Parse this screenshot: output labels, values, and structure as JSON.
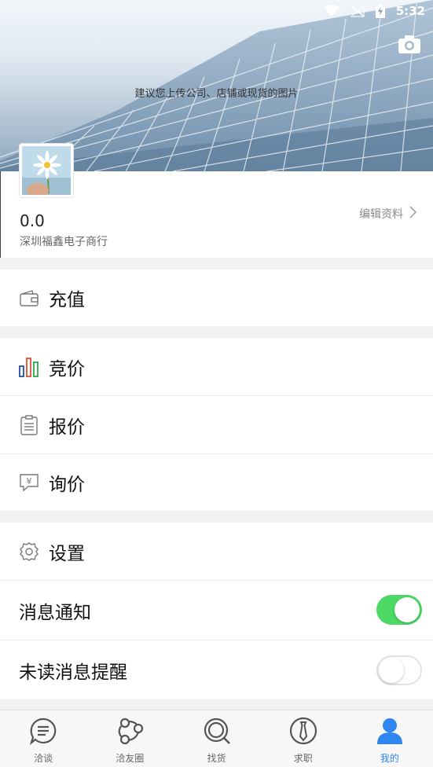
{
  "status_bar": {
    "time": "5:32"
  },
  "header": {
    "upload_hint": "建议您上传公司、店铺或现货的图片"
  },
  "profile": {
    "balance": "0.0",
    "company": "深圳福鑫电子商行",
    "edit_label": "编辑资料"
  },
  "menu": {
    "recharge": "充值",
    "bidding": "竞价",
    "quote": "报价",
    "inquiry": "询价",
    "settings": "设置",
    "notifications": "消息通知",
    "unread_reminder": "未读消息提醒"
  },
  "toggles": {
    "notifications_on": true,
    "unread_reminder_on": false
  },
  "nav": {
    "items": [
      {
        "label": "洽谈",
        "icon": "chat-icon"
      },
      {
        "label": "洽友圈",
        "icon": "friends-circle-icon"
      },
      {
        "label": "找货",
        "icon": "search-goods-icon"
      },
      {
        "label": "求职",
        "icon": "job-tie-icon"
      },
      {
        "label": "我的",
        "icon": "profile-icon"
      }
    ],
    "active_index": 4
  },
  "colors": {
    "accent_blue": "#2f86f0",
    "toggle_on": "#4cd964"
  }
}
